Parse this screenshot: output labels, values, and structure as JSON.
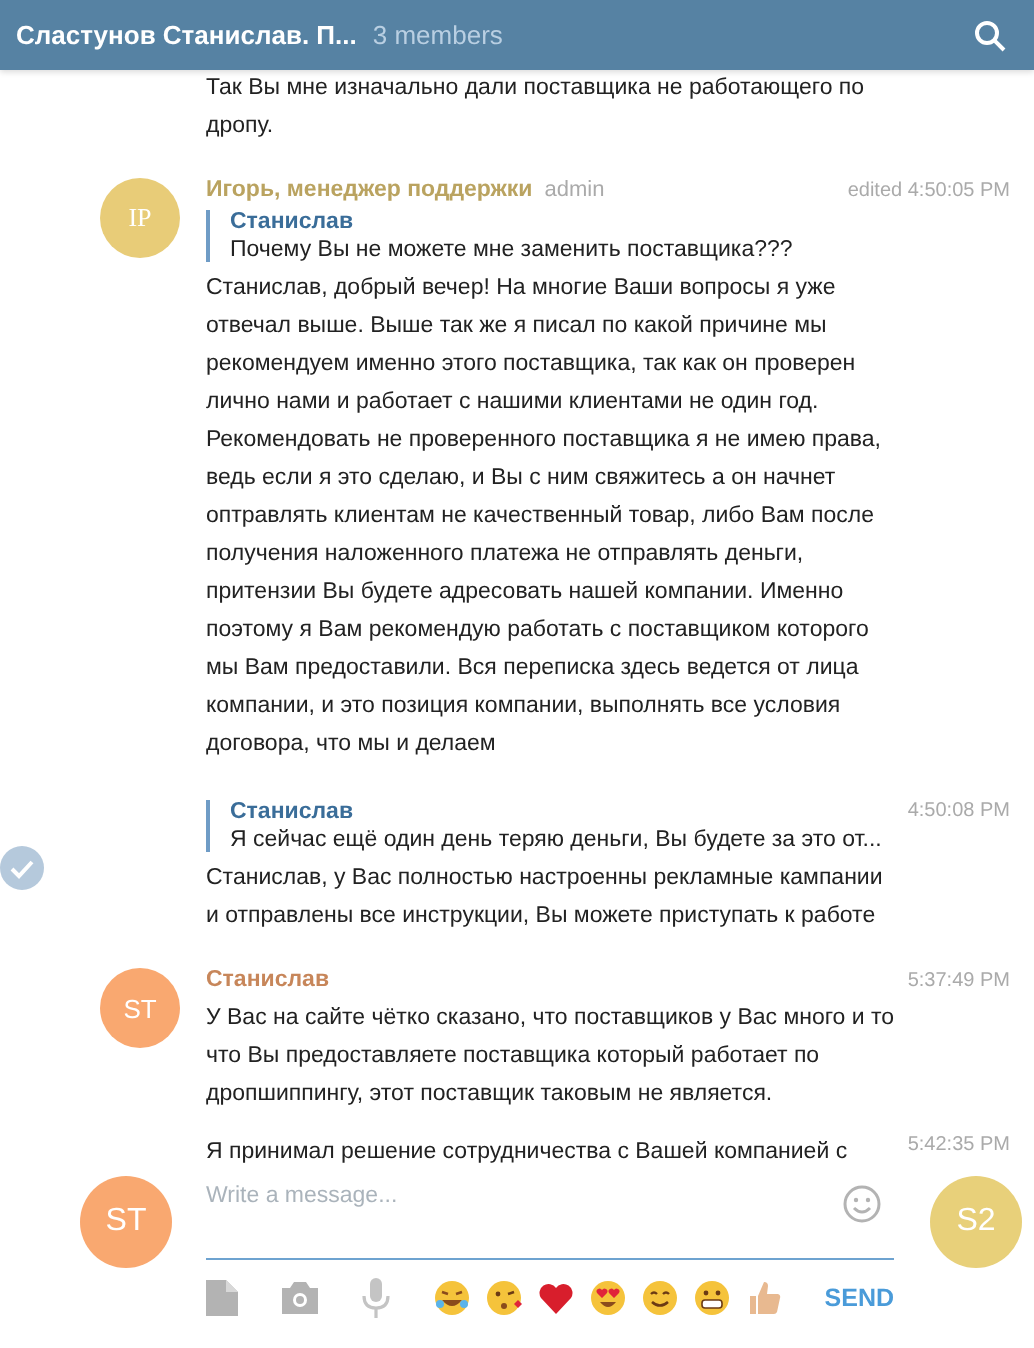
{
  "header": {
    "title": "Сластунов Станислав. П...",
    "subtitle": "3 members"
  },
  "messages": [
    {
      "kind": "continuation",
      "selected": false,
      "text": "Так Вы мне изначально дали поставщика не работающего по дропу."
    },
    {
      "kind": "full",
      "selected": false,
      "avatar": {
        "initials": "IP",
        "color": "#e8cc78"
      },
      "author": "Игорь, менеджер поддержки",
      "badge": "admin",
      "time": "edited 4:50:05 PM",
      "reply": {
        "author": "Станислав",
        "text": "Почему Вы не можете мне заменить поставщика???"
      },
      "text": "Станислав, добрый вечер! На многие Ваши вопросы я уже отвечал выше. Выше так же я писал по какой причине мы рекомендуем именно этого поставщика, так как он проверен лично нами и работает с нашими клиентами не один год. Рекомендовать не проверенного поставщика я не имею права, ведь если я это сделаю, и Вы с ним свяжитесь а он начнет оптравлять клиентам не качественный товар, либо Вам после получения наложенного платежа не отправлять деньги, притензии Вы будете адресовать нашей компании. Именно поэтому я Вам рекомендую работать с поставщиком которого мы Вам предоставили. Вся переписка здесь ведется от лица компании, и это позиция компании, выполнять все условия договора, что мы и делаем"
    },
    {
      "kind": "continuation",
      "selected": true,
      "time": "4:50:08 PM",
      "reply": {
        "author": "Станислав",
        "text": "Я сейчас ещё один день теряю деньги, Вы будете за это от..."
      },
      "text": "Станислав, у Вас полностью настроенны рекламные кампании и отправлены все инструкции, Вы можете приступать к работе"
    },
    {
      "kind": "full",
      "selected": false,
      "avatar": {
        "initials": "ST",
        "color": "#f9a870"
      },
      "author": "Станислав",
      "time": "5:37:49 PM",
      "text": "У Вас на сайте чётко сказано, что поставщиков у Вас много и то что Вы предоставляете поставщика который работает по дропшиппингу, этот поставщик таковым не является."
    },
    {
      "kind": "continuation",
      "selected": false,
      "time": "5:42:35 PM",
      "text": "Я принимал решение сотрудничества с Вашей компанией с"
    }
  ],
  "composer": {
    "placeholder": "Write a message...",
    "left_avatar": {
      "initials": "ST",
      "color": "#f9a870"
    },
    "right_avatar": {
      "initials": "S2",
      "color": "#e8d07a"
    },
    "send": "SEND"
  }
}
